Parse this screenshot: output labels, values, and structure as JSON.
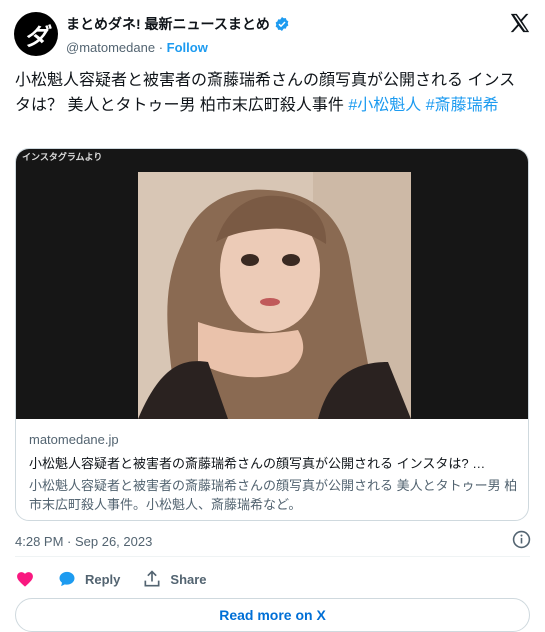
{
  "account": {
    "avatar_glyph": "ダ",
    "display_name": "まとめダネ!  最新ニュースまとめ",
    "handle": "@matomedane",
    "separator": "·",
    "follow_label": "Follow"
  },
  "tweet": {
    "text": "小松魁人容疑者と被害者の斎藤瑞希さんの顔写真が公開される インスタは？ 美人とタトゥー男 柏市末広町殺人事件 ",
    "hashtags": [
      "#小松魁人",
      "#斎藤瑞希"
    ]
  },
  "card": {
    "media_label": "インスタグラムより",
    "domain": "matomedane.jp",
    "title": "小松魁人容疑者と被害者の斎藤瑞希さんの顔写真が公開される インスタは?  …",
    "description": "小松魁人容疑者と被害者の斎藤瑞希さんの顔写真が公開される 美人とタトゥー男 柏市末広町殺人事件。小松魁人、斎藤瑞希など。"
  },
  "meta": {
    "timestamp": "4:28 PM · Sep 26, 2023"
  },
  "actions": {
    "reply_label": "Reply",
    "share_label": "Share",
    "read_more_label": "Read more on X"
  },
  "colors": {
    "accent": "#1d9bf0",
    "like": "#f91880",
    "secondary_text": "#536471"
  }
}
